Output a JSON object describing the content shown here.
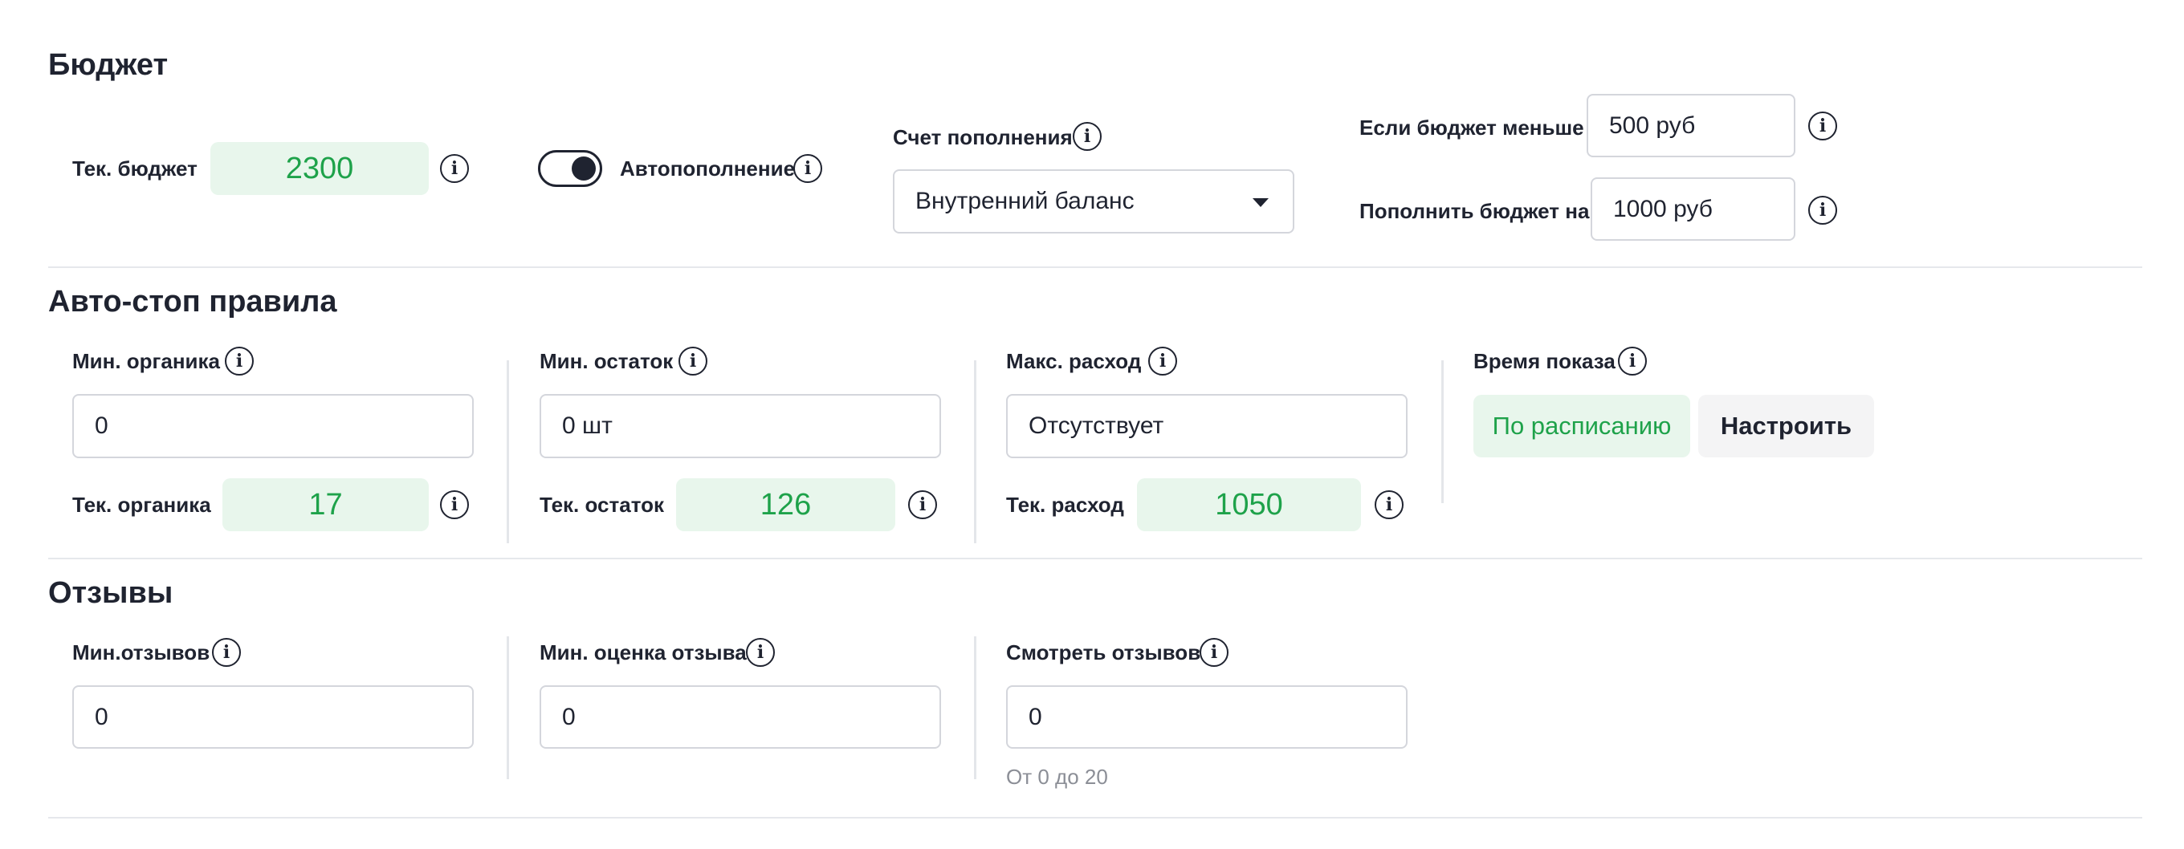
{
  "budget": {
    "title": "Бюджет",
    "current_budget_label": "Тек. бюджет",
    "current_budget_value": "2300",
    "autotopup_label": "Автопополнение",
    "autotopup_on": true,
    "account_label": "Счет пополнения",
    "account_selected": "Внутренний баланс",
    "if_less_label": "Если бюджет меньше",
    "if_less_value": "500 руб",
    "topup_by_label": "Пополнить бюджет на",
    "topup_by_value": "1000 руб"
  },
  "autostop": {
    "title": "Авто-стоп правила",
    "min_organic_label": "Мин. органика",
    "min_organic_value": "0",
    "cur_organic_label": "Тек. органика",
    "cur_organic_value": "17",
    "min_stock_label": "Мин. остаток",
    "min_stock_value": "0 шт",
    "cur_stock_label": "Тек. остаток",
    "cur_stock_value": "126",
    "max_spend_label": "Макс. расход",
    "max_spend_value": "Отсутствует",
    "cur_spend_label": "Тек. расход",
    "cur_spend_value": "1050",
    "show_time_label": "Время показа",
    "schedule_button": "По расписанию",
    "configure_button": "Настроить"
  },
  "reviews": {
    "title": "Отзывы",
    "min_reviews_label": "Мин.отзывов",
    "min_reviews_value": "0",
    "min_rating_label": "Мин. оценка отзыва",
    "min_rating_value": "0",
    "view_reviews_label": "Смотреть отзывов",
    "view_reviews_value": "0",
    "view_reviews_hint": "От 0 до 20"
  },
  "info_icon_glyph": "i",
  "colors": {
    "accent_green": "#1ea24a",
    "green_bg": "#e8f6ec",
    "text": "#1f2330",
    "border": "#d4d6dc"
  }
}
